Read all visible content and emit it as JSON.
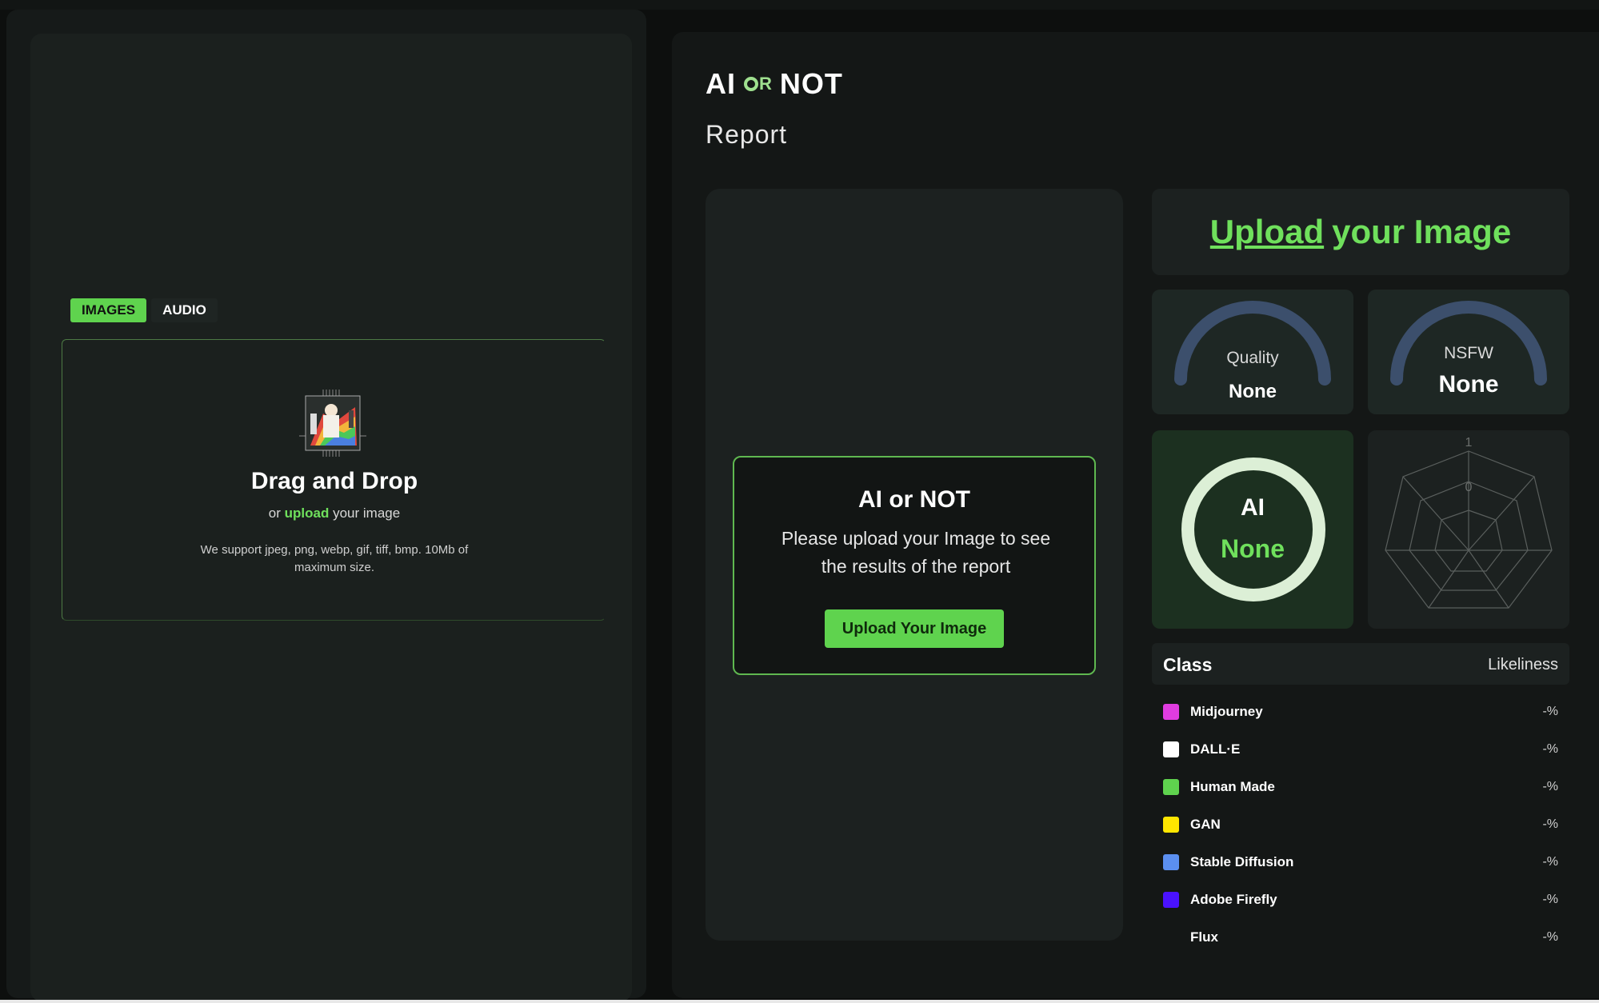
{
  "tabs": [
    {
      "label": "IMAGES"
    },
    {
      "label": "AUDIO"
    }
  ],
  "dropzone": {
    "title": "Drag and Drop",
    "sub_prefix": "or",
    "sub_link": "upload",
    "sub_suffix": "your image",
    "note": "We support jpeg, png, webp, gif, tiff, bmp. 10Mb of maximum size."
  },
  "header": {
    "brand_left": "AI",
    "brand_or": "R",
    "brand_right": "NOT",
    "report_title": "Report"
  },
  "message": {
    "title": "AI or NOT",
    "text": "Please upload your Image to see the results of the report",
    "button": "Upload Your Image"
  },
  "upload_card": {
    "link": "Upload",
    "rest": "your Image"
  },
  "gauges": {
    "quality": {
      "label": "Quality",
      "value": "None"
    },
    "nsfw": {
      "label": "NSFW",
      "value": "None"
    }
  },
  "ai_score": {
    "label": "AI",
    "value": "None"
  },
  "radar": {
    "tick_top": "1",
    "tick_center": "0"
  },
  "class_table": {
    "col_class": "Class",
    "col_likeliness": "Likeliness",
    "rows": [
      {
        "name": "Midjourney",
        "value": "-%",
        "color": "#e03ce0"
      },
      {
        "name": "DALL·E",
        "value": "-%",
        "color": "#ffffff"
      },
      {
        "name": "Human Made",
        "value": "-%",
        "color": "#5fd34e"
      },
      {
        "name": "GAN",
        "value": "-%",
        "color": "#ffe600"
      },
      {
        "name": "Stable Diffusion",
        "value": "-%",
        "color": "#5b8ff0"
      },
      {
        "name": "Adobe Firefly",
        "value": "-%",
        "color": "#4a12ff"
      },
      {
        "name": "Flux",
        "value": "-%",
        "color": "transparent"
      }
    ]
  },
  "colors": {
    "accent": "#5fd34e",
    "background": "#0d0f0e"
  }
}
